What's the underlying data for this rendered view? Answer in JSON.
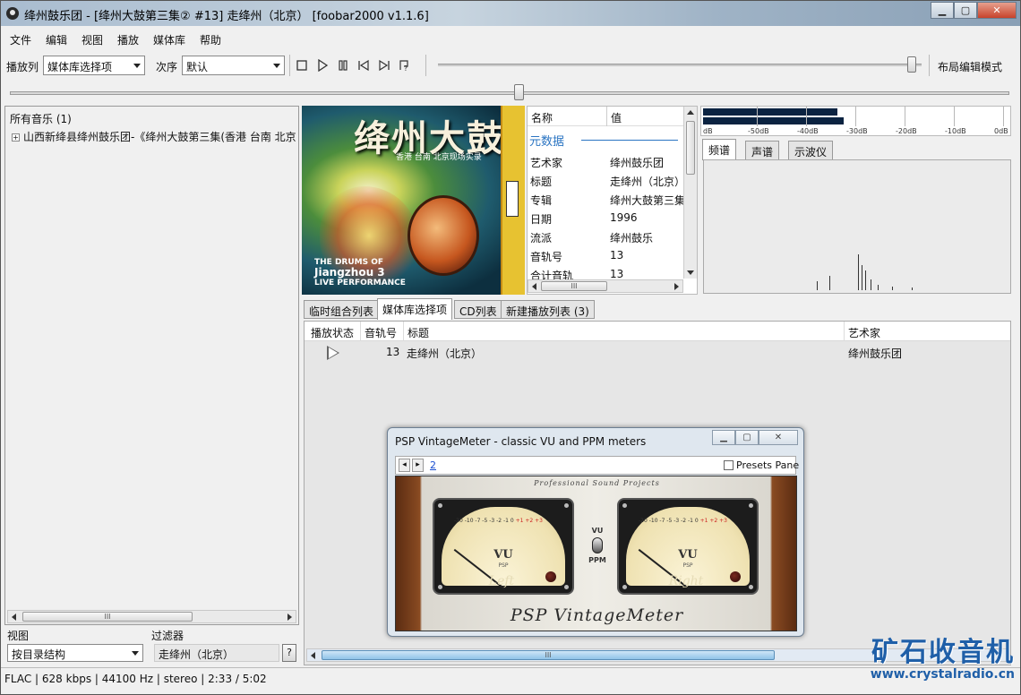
{
  "window": {
    "title": "绛州鼓乐团 - [绛州大鼓第三集② #13] 走绛州（北京）   [foobar2000 v1.1.6]",
    "min_label": "▁",
    "max_label": "▢",
    "close_label": "✕"
  },
  "menu": [
    "文件",
    "编辑",
    "视图",
    "播放",
    "媒体库",
    "帮助"
  ],
  "toolbar": {
    "playlist_label": "播放列",
    "playlist_value": "媒体库选择项",
    "order_label": "次序",
    "order_value": "默认",
    "layout_mode": "布局编辑模式",
    "volume_level": 0.98
  },
  "seek": {
    "position": 0.509
  },
  "library": {
    "root": "所有音乐 (1)",
    "node": "山西新绛县绛州鼓乐团-《绛州大鼓第三集(香港 台南 北京",
    "view_label": "视图",
    "view_value": "按目录结构",
    "filter_label": "过滤器",
    "filter_value": "走绛州（北京）",
    "help_label": "?"
  },
  "album_art": {
    "title": "绛州大鼓",
    "subtitle": "香港 台南 北京现场实录",
    "english": [
      "THE DRUMS OF",
      "Jiangzhou 3",
      "LIVE PERFORMANCE"
    ]
  },
  "properties": {
    "col_name": "名称",
    "col_value": "值",
    "section": "元数据",
    "rows": [
      {
        "k": "艺术家",
        "v": "绛州鼓乐团"
      },
      {
        "k": "标题",
        "v": "走绛州（北京）"
      },
      {
        "k": "专辑",
        "v": "绛州大鼓第三集"
      },
      {
        "k": "日期",
        "v": "1996"
      },
      {
        "k": "流派",
        "v": "绛州鼓乐"
      },
      {
        "k": "音轨号",
        "v": "13"
      },
      {
        "k": "合计音轨",
        "v": "13"
      }
    ]
  },
  "peak_meter": {
    "labels": [
      "dB",
      "-50dB",
      "-40dB",
      "-30dB",
      "-20dB",
      "-10dB",
      "0dB"
    ],
    "levels": [
      0.44,
      0.46
    ]
  },
  "vis_tabs": [
    "频谱",
    "声谱",
    "示波仪"
  ],
  "playlist_tabs": [
    "临时组合列表",
    "媒体库选择项",
    "CD列表",
    "新建播放列表 (3)"
  ],
  "playlist": {
    "headers": {
      "status": "播放状态",
      "track": "音轨号",
      "title": "标题",
      "artist": "艺术家"
    },
    "rows": [
      {
        "track": "13",
        "title": "走绛州（北京）",
        "artist": "绛州鼓乐团"
      }
    ]
  },
  "status": "FLAC | 628 kbps | 44100 Hz | stereo | 2:33 / 5:02",
  "watermark": {
    "cn": "矿石收音机",
    "url": "www.crystalradio.cn"
  },
  "vintage_meter": {
    "title": "PSP VintageMeter - classic VU and PPM meters",
    "page": "2",
    "presets": "Presets Pane",
    "brand": "Professional Sound Projects",
    "vu": "VU",
    "psp": "PSP",
    "mode_top": "VU",
    "mode_bottom": "PPM",
    "left": "Left",
    "right": "Right",
    "name": "PSP VintageMeter",
    "scale": "-20 -10 -7 -5 -3 -2 -1 0",
    "scale_red": "+1 +2 +3"
  }
}
